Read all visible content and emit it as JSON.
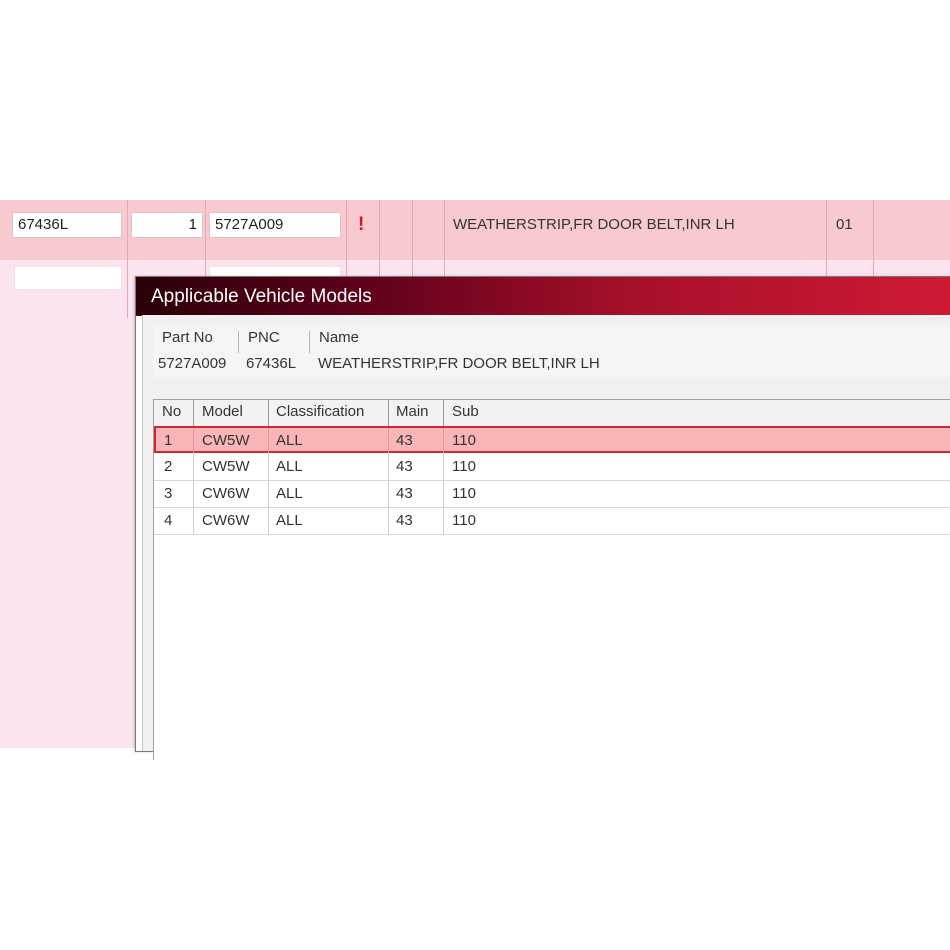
{
  "parts_row": {
    "pnc": "67436L",
    "qty": "1",
    "part_no": "5727A009",
    "warning": "!",
    "name": "WEATHERSTRIP,FR DOOR BELT,INR LH",
    "code": "01"
  },
  "dialog": {
    "title": "Applicable Vehicle Models",
    "header_labels": {
      "part_no": "Part No",
      "pnc": "PNC",
      "name": "Name"
    },
    "header_values": {
      "part_no": "5727A009",
      "pnc": "67436L",
      "name": "WEATHERSTRIP,FR DOOR BELT,INR LH"
    },
    "columns": {
      "no": "No",
      "model": "Model",
      "classification": "Classification",
      "main": "Main",
      "sub": "Sub"
    },
    "rows": [
      {
        "no": "1",
        "model": "CW5W",
        "classification": "ALL",
        "main": "43",
        "sub": "110",
        "selected": true
      },
      {
        "no": "2",
        "model": "CW5W",
        "classification": "ALL",
        "main": "43",
        "sub": "110",
        "selected": false
      },
      {
        "no": "3",
        "model": "CW6W",
        "classification": "ALL",
        "main": "43",
        "sub": "110",
        "selected": false
      },
      {
        "no": "4",
        "model": "CW6W",
        "classification": "ALL",
        "main": "43",
        "sub": "110",
        "selected": false
      }
    ]
  },
  "colors": {
    "row_highlight": "#f9c9d0",
    "background_pink": "#fbe3ef",
    "title_gradient_start": "#2a0008",
    "title_gradient_end": "#d31a36",
    "selected_row": "#f9b4b7",
    "selected_border": "#c82a32",
    "warning": "#d11b1b"
  }
}
